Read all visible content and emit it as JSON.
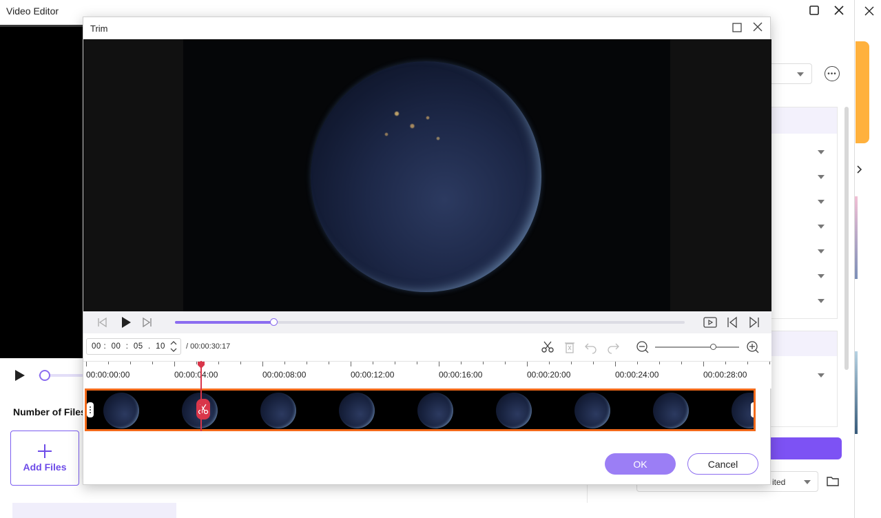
{
  "app": {
    "title": "Video Editor",
    "number_of_files_label": "Number of Files",
    "add_files_label": "Add Files",
    "output_text": "ited"
  },
  "trim": {
    "title": "Trim",
    "current_time": "00 :  00  :  05  .  10",
    "total_time": "/ 00:00:30:17",
    "seek_progress": 0.193,
    "zoom_level": 0.69,
    "ok_label": "OK",
    "cancel_label": "Cancel",
    "ruler_labels": [
      "00:00:00:00",
      "00:00:04:00",
      "00:00:08:00",
      "00:00:12:00",
      "00:00:16:00",
      "00:00:20:00",
      "00:00:24:00",
      "00:00:28:00"
    ],
    "frame_count": 9
  },
  "colors": {
    "accent": "#8b6cf0",
    "playhead": "#d9364a",
    "selection": "#f26a1b"
  },
  "icons": {
    "play": "play-icon",
    "prev_frame": "prev-frame-icon",
    "next_frame": "next-frame-icon",
    "cut": "scissors-icon",
    "delete": "delete-icon",
    "undo": "undo-icon",
    "redo": "redo-icon",
    "zoom_in": "zoom-in-icon",
    "zoom_out": "zoom-out-icon"
  }
}
